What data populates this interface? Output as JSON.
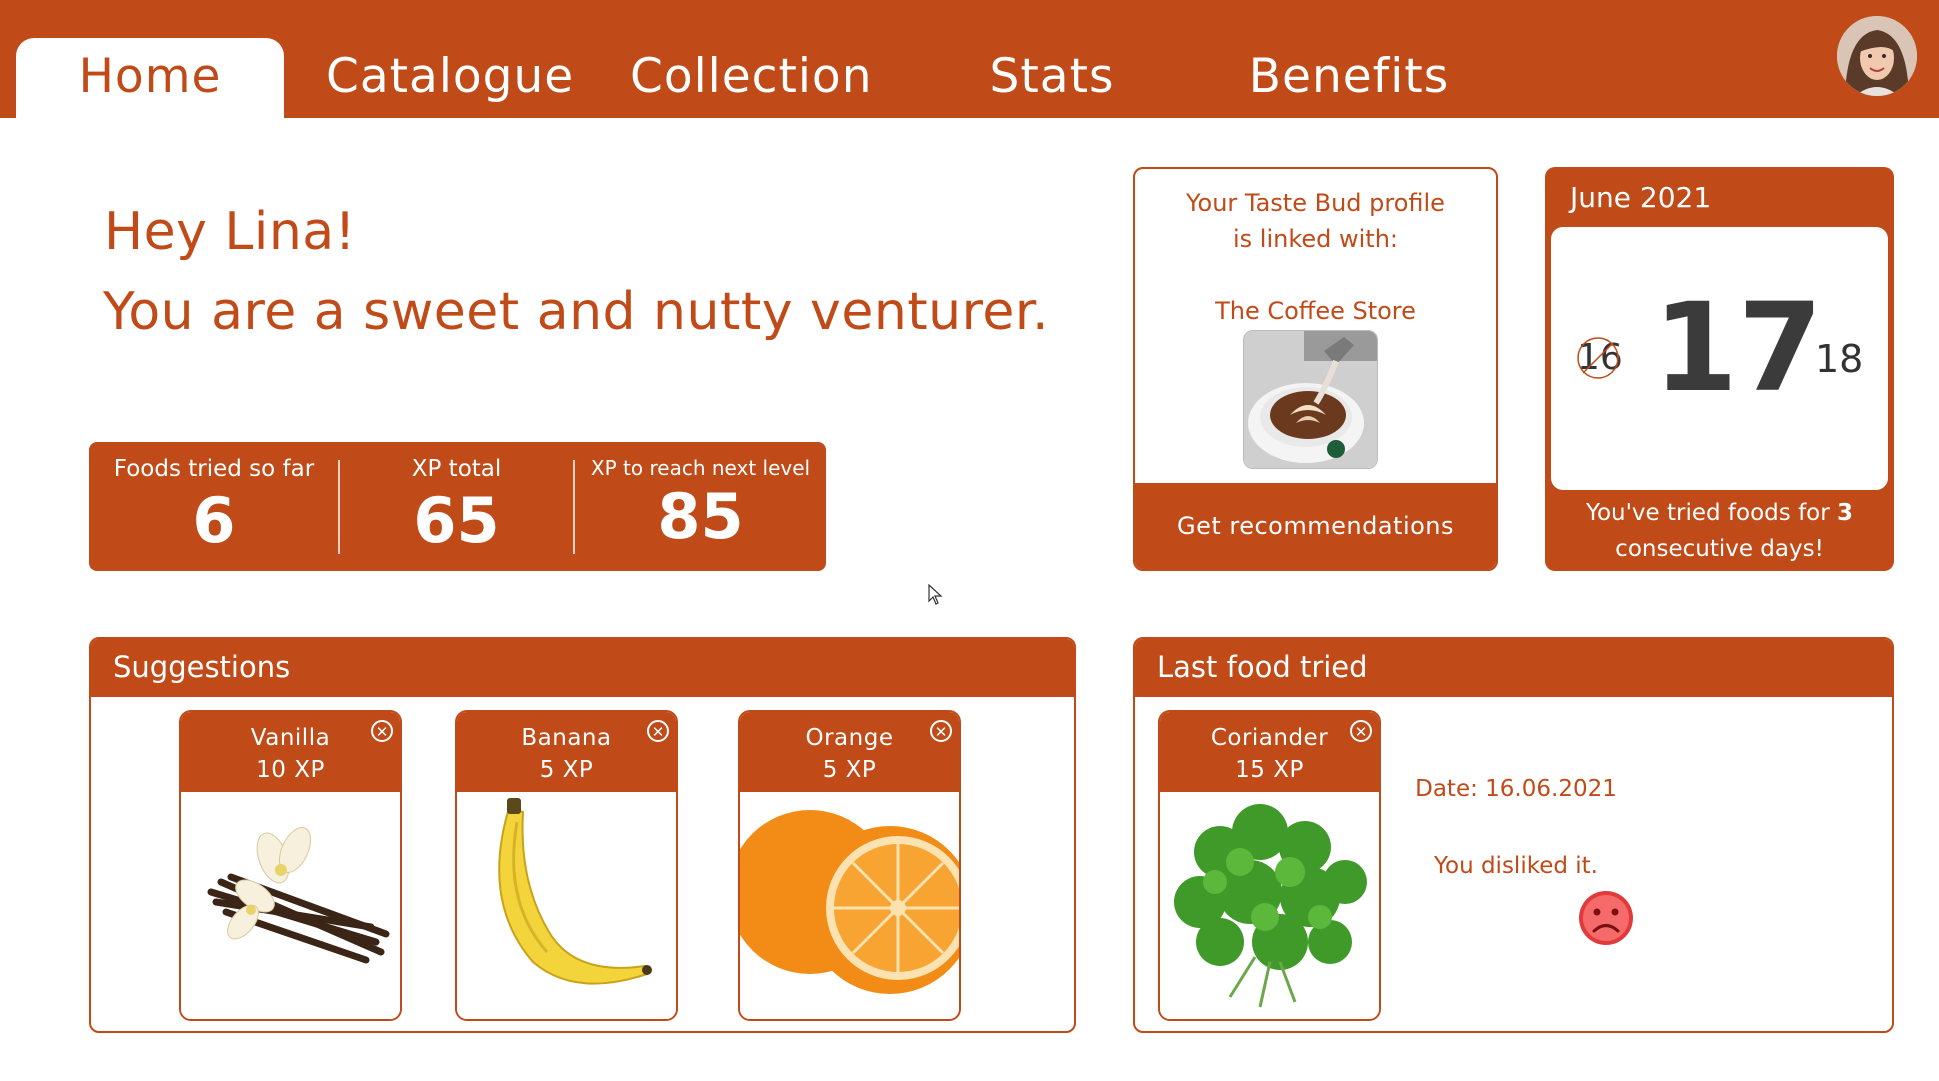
{
  "nav": {
    "tabs": [
      {
        "label": "Home",
        "active": true
      },
      {
        "label": "Catalogue"
      },
      {
        "label": "Collection"
      },
      {
        "label": "Stats"
      },
      {
        "label": "Benefits"
      }
    ],
    "avatar_icon": "user-avatar"
  },
  "greeting": {
    "line1": "Hey Lina!",
    "line2": "You are a sweet and nutty venturer."
  },
  "stats": [
    {
      "label": "Foods tried so far",
      "value": "6"
    },
    {
      "label": "XP total",
      "value": "65"
    },
    {
      "label": "XP to reach next level",
      "value": "85"
    }
  ],
  "linked": {
    "line1": "Your Taste Bud profile",
    "line2": "is linked with:",
    "store": "The Coffee Store",
    "button": "Get recommendations"
  },
  "calendar": {
    "month": "June 2021",
    "prev_day": "16",
    "today": "17",
    "next_day": "18",
    "note_prefix": "You've tried foods for ",
    "note_count": "3",
    "note_suffix": "consecutive days!"
  },
  "suggestions": {
    "title": "Suggestions",
    "items": [
      {
        "name": "Vanilla",
        "xp": "10 XP"
      },
      {
        "name": "Banana",
        "xp": "5 XP"
      },
      {
        "name": "Orange",
        "xp": "5 XP"
      }
    ]
  },
  "last_food": {
    "title": "Last food tried",
    "name": "Coriander",
    "xp": "15 XP",
    "date": "Date: 16.06.2021",
    "verdict": "You disliked it.",
    "mood_icon": "sad-face-icon"
  },
  "colors": {
    "accent": "#c04a18",
    "sad_face": "#e23a3a"
  }
}
